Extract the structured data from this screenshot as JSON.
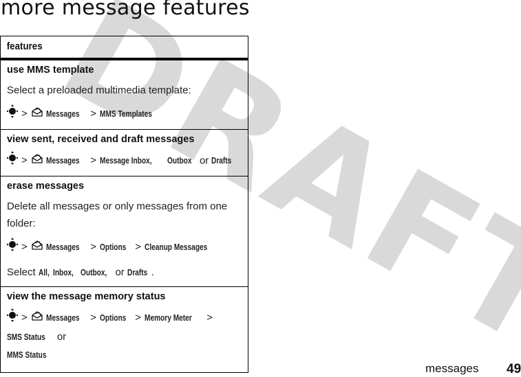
{
  "page": {
    "title": "more message features",
    "watermark": "DRAFT",
    "watermark_color": "#d9d9d9"
  },
  "table": {
    "header": "features",
    "rows": [
      {
        "name": "use MMS template",
        "description": "Select a preloaded multimedia template:",
        "path": [
          "Messages",
          "MMS Templates"
        ]
      },
      {
        "name": "view sent, received and draft messages",
        "path": [
          "Messages",
          "Message Inbox,"
        ],
        "path_tail": {
          "item1": "Outbox",
          "or": "or",
          "item2": "Drafts"
        }
      },
      {
        "name": "erase messages",
        "description": "Delete all messages or only messages from one folder:",
        "path": [
          "Messages",
          "Options",
          "Cleanup Messages"
        ],
        "select_note": {
          "prefix": "Select",
          "options": [
            "All,",
            "Inbox,",
            "Outbox,"
          ],
          "or": "or",
          "last": "Drafts",
          "suffix": "."
        }
      },
      {
        "name": "view the message memory status",
        "path": [
          "Messages",
          "Options",
          "Memory Meter",
          "SMS Status"
        ],
        "path_tail": {
          "or": "or",
          "item2": "MMS Status"
        }
      }
    ],
    "separator": ">",
    "icons": {
      "nav": "nav-key-icon",
      "messages": "messages-envelope-icon"
    }
  },
  "footer": {
    "section": "messages",
    "page_number": "49"
  }
}
